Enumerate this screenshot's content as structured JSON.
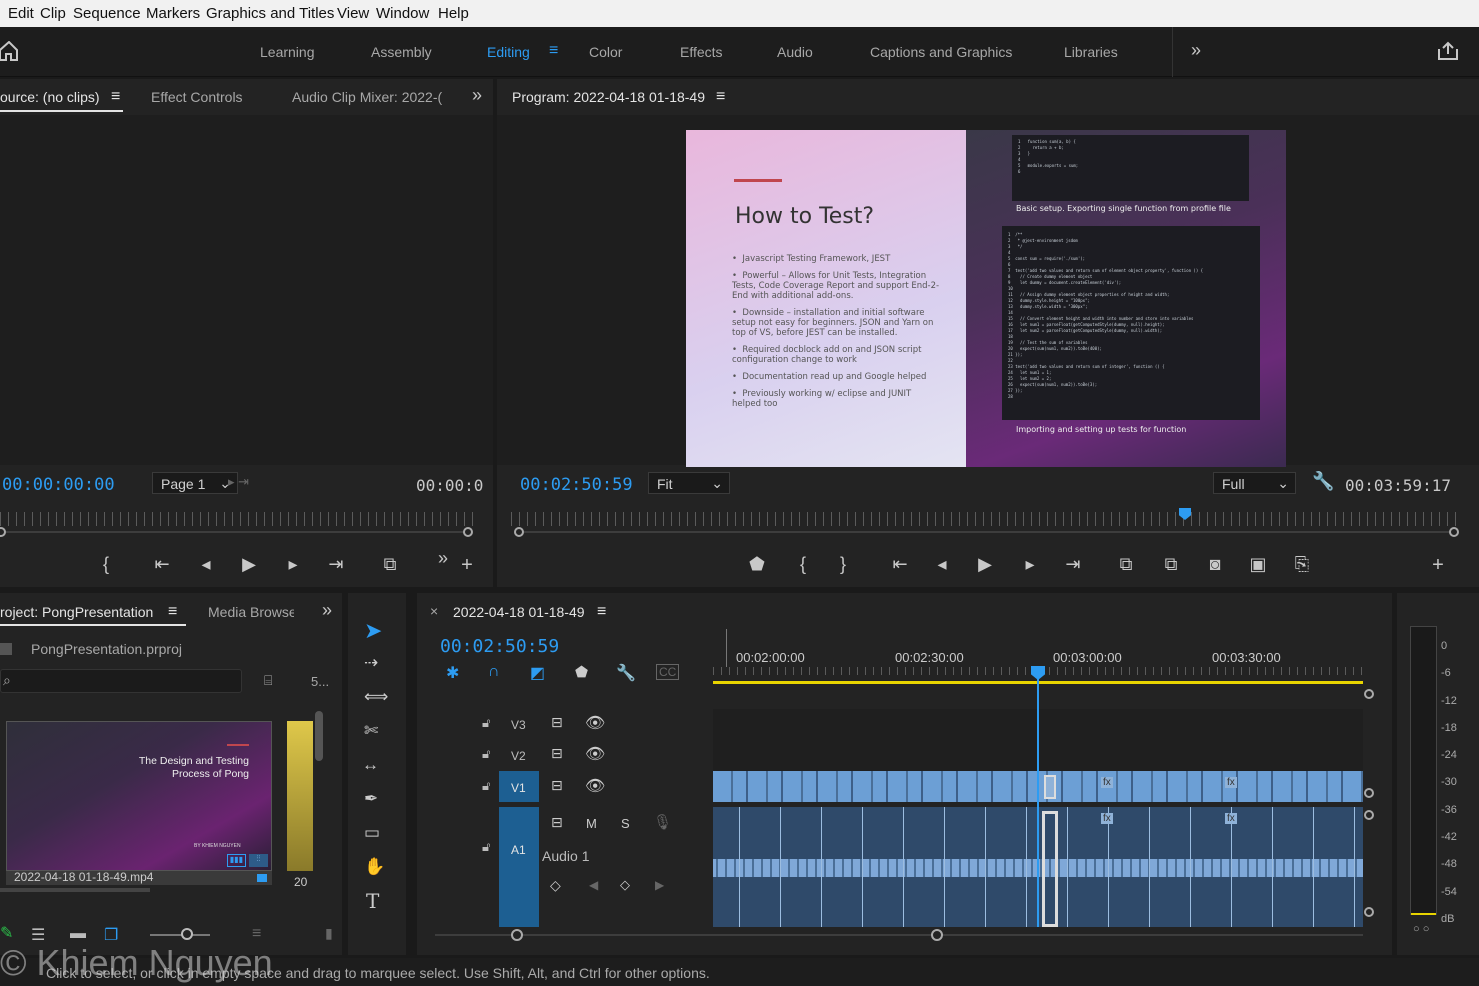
{
  "menu": [
    "Edit",
    "Clip",
    "Sequence",
    "Markers",
    "Graphics and Titles",
    "View",
    "Window",
    "Help"
  ],
  "workspaces": [
    "Learning",
    "Assembly",
    "Editing",
    "Color",
    "Effects",
    "Audio",
    "Captions and Graphics",
    "Libraries"
  ],
  "workspace_active": "Editing",
  "source_panel": {
    "tabs": [
      "ource: (no clips)",
      "Effect Controls",
      "Audio Clip Mixer: 2022-("
    ],
    "timecode_in": "00:00:00:00",
    "page_select": "Page 1",
    "timecode_out": "00:00:0"
  },
  "program_panel": {
    "title": "Program: 2022-04-18 01-18-49",
    "timecode": "00:02:50:59",
    "fit": "Fit",
    "quality": "Full",
    "duration": "00:03:59:17",
    "slide": {
      "title": "How to Test?",
      "bullets": [
        "Javascript Testing Framework, JEST",
        "Powerful – Allows for Unit Tests, Integration Tests, Code Coverage Report and support End-2-End with additional add-ons.",
        "Downside – installation and initial software setup not easy for beginners. JSON and Yarn on top of VS, before JEST can be installed.",
        "Required docblock add on and JSON script configuration change to work",
        "Documentation read up and Google helped",
        "Previously working w/ eclipse and JUNIT helped too"
      ],
      "caption1": "Basic setup. Exporting single function from profile file",
      "caption2": "Importing and setting up tests for function"
    }
  },
  "project_panel": {
    "tabs": [
      "roject: PongPresentation",
      "Media Browse"
    ],
    "file": "PongPresentation.prproj",
    "count": "5...",
    "thumb_title": "The Design and Testing\nProcess of Pong",
    "thumb_byline": "BY KHIEM NGUYEN",
    "thumb_label": "2022-04-18 01-18-49.mp4",
    "thumb2_label": "20"
  },
  "timeline": {
    "sequence": "2022-04-18 01-18-49",
    "timecode": "00:02:50:59",
    "ruler_times": [
      "00:02:00:00",
      "00:02:30:00",
      "00:03:00:00",
      "00:03:30:00"
    ],
    "tracks": [
      {
        "id": "V3"
      },
      {
        "id": "V2"
      },
      {
        "id": "V1"
      }
    ],
    "audio_track": {
      "id": "A1",
      "name": "Audio 1",
      "m": "M",
      "s": "S"
    }
  },
  "meter_labels": [
    "0",
    "-6",
    "-12",
    "-18",
    "-24",
    "-30",
    "-36",
    "-42",
    "-48",
    "-54",
    "dB"
  ],
  "status_text": "Click to select, or click in empty space and drag to marquee select. Use Shift, Alt, and Ctrl for other options.",
  "watermark": "© Khiem Nguyen",
  "colors": {
    "accent": "#2d9cf2",
    "clip": "#6c9fd5",
    "playhead": "#2d9cf2",
    "workarea": "#e8d400"
  }
}
